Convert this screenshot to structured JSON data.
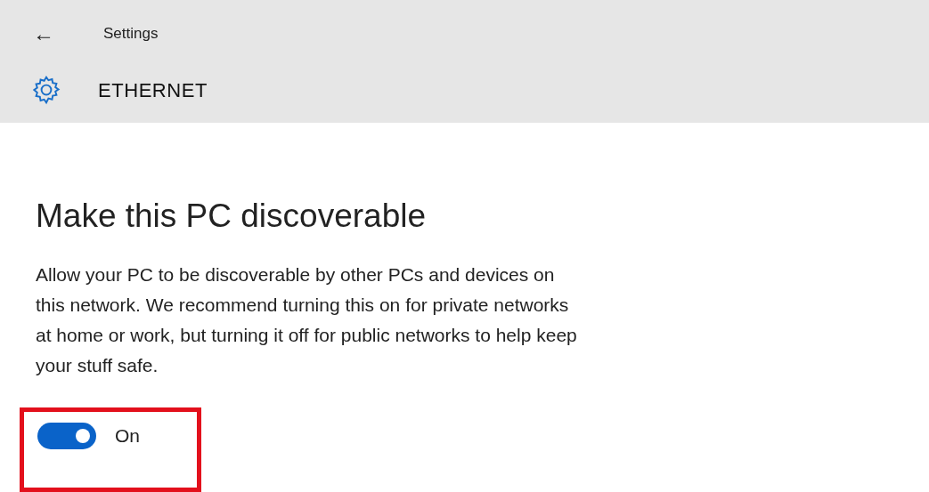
{
  "header": {
    "back": "←",
    "title": "Settings"
  },
  "page": {
    "title": "ETHERNET"
  },
  "section": {
    "heading": "Make this PC discoverable",
    "description": "Allow your PC to be discoverable by other PCs and devices on this network. We recommend turning this on for private networks at home or work, but turning it off for public networks to help keep your stuff safe.",
    "toggle": {
      "on": true,
      "label": "On"
    }
  }
}
